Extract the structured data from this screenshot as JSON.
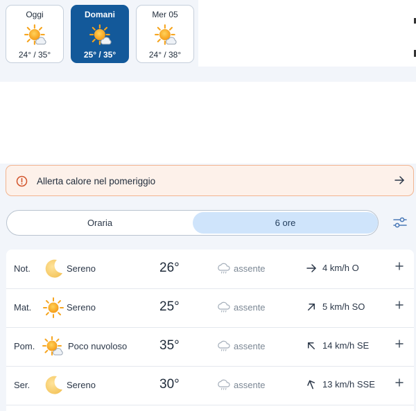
{
  "days": [
    {
      "label": "Oggi",
      "temps": "24° / 35°",
      "icon": "sun-cloud-icon",
      "active": false
    },
    {
      "label": "Domani",
      "temps": "25° / 35°",
      "icon": "sun-cloud-icon",
      "active": true
    },
    {
      "label": "Mer 05",
      "temps": "24° / 38°",
      "icon": "sun-cloud-icon",
      "active": false
    }
  ],
  "alert": {
    "text": "Allerta calore nel pomeriggio",
    "icon": "alert-circle-icon",
    "color": "#f2b48f"
  },
  "toggle": {
    "hourly": "Oraria",
    "six_hours": "6 ore",
    "selected": "6 ore"
  },
  "rows": [
    {
      "period": "Not.",
      "icon": "moon-icon",
      "condition": "Sereno",
      "temp": "26°",
      "precip": "assente",
      "wind": "4 km/h O"
    },
    {
      "period": "Mat.",
      "icon": "sun-icon",
      "condition": "Sereno",
      "temp": "25°",
      "precip": "assente",
      "wind": "5 km/h SO"
    },
    {
      "period": "Pom.",
      "icon": "sun-cloud-icon",
      "condition": "Poco nuvoloso",
      "temp": "35°",
      "precip": "assente",
      "wind": "14 km/h SE"
    },
    {
      "period": "Ser.",
      "icon": "moon-icon",
      "condition": "Sereno",
      "temp": "30°",
      "precip": "assente",
      "wind": "13 km/h SSE"
    }
  ],
  "colors": {
    "active_day": "#13599a",
    "selected_toggle": "#cfe4fb",
    "sun": "#f6a51f"
  }
}
